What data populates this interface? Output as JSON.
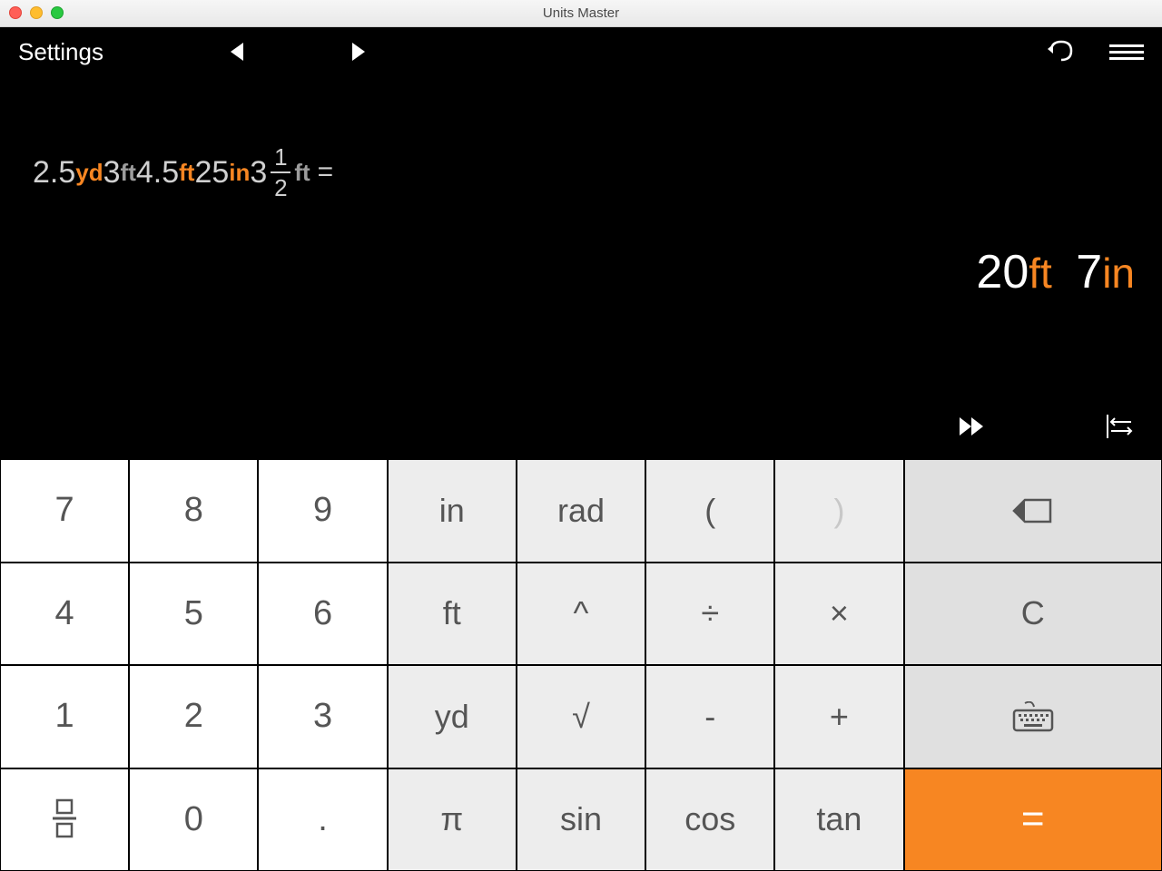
{
  "window": {
    "title": "Units Master"
  },
  "topbar": {
    "settings": "Settings"
  },
  "expression": {
    "tokens": [
      {
        "t": "num",
        "v": "2.5"
      },
      {
        "t": "unit",
        "v": "yd",
        "c": "or"
      },
      {
        "t": "num",
        "v": "3"
      },
      {
        "t": "unit",
        "v": "ft",
        "c": "gr"
      },
      {
        "t": "num",
        "v": "4.5"
      },
      {
        "t": "unit",
        "v": "ft",
        "c": "or"
      },
      {
        "t": "num",
        "v": "25"
      },
      {
        "t": "unit",
        "v": "in",
        "c": "or"
      },
      {
        "t": "num",
        "v": "3"
      },
      {
        "t": "frac",
        "n": "1",
        "d": "2"
      },
      {
        "t": "unit",
        "v": "ft",
        "c": "gr"
      }
    ],
    "equals": "="
  },
  "result": {
    "v1": "20",
    "u1": "ft",
    "v2": "7",
    "u2": "in"
  },
  "keys": {
    "r0": [
      "7",
      "8",
      "9",
      "in",
      "rad",
      "(",
      ")",
      "backspace-icon"
    ],
    "r1": [
      "4",
      "5",
      "6",
      "ft",
      "^",
      "÷",
      "×",
      "C"
    ],
    "r2": [
      "1",
      "2",
      "3",
      "yd",
      "√",
      "-",
      "+",
      "keyboard-icon"
    ],
    "r3": [
      "fraction-icon",
      "0",
      ".",
      "π",
      "sin",
      "cos",
      "tan",
      "="
    ]
  }
}
